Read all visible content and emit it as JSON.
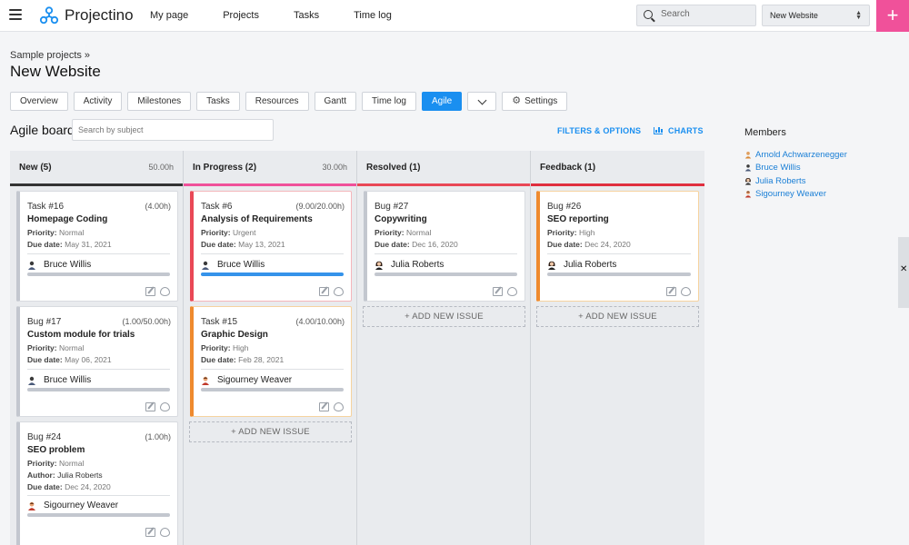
{
  "app": {
    "name": "Projectino"
  },
  "nav": {
    "my_page": "My page",
    "projects": "Projects",
    "tasks": "Tasks",
    "time_log": "Time log"
  },
  "search": {
    "placeholder": "Search"
  },
  "project_select": {
    "value": "New Website"
  },
  "colors": {
    "accent": "#1a8ff0",
    "plus": "#f0519a",
    "red": "#e94856",
    "orange": "#ef8a2e",
    "pink": "#f0519a",
    "dark": "#333333"
  },
  "breadcrumb": "Sample projects »",
  "page_title": "New Website",
  "tabs": [
    "Overview",
    "Activity",
    "Milestones",
    "Tasks",
    "Resources",
    "Gantt",
    "Time log",
    "Agile",
    "",
    "Settings"
  ],
  "board": {
    "title": "Agile board",
    "search_placeholder": "Search by subject",
    "filters_label": "FILTERS & OPTIONS",
    "charts_label": "CHARTS",
    "add_issue_label": "+ ADD NEW ISSUE",
    "columns": [
      {
        "name": "New (5)",
        "hours": "50.00h",
        "cards": [
          {
            "title": "Task #16",
            "estimate": "(4.00h)",
            "subject": "Homepage Coding",
            "priority_label": "Priority:",
            "priority": "Normal",
            "due_label": "Due date:",
            "due": "May 31, 2021",
            "assignee": "Bruce Willis",
            "progress": 0
          },
          {
            "title": "Bug #17",
            "estimate": "(1.00/50.00h)",
            "subject": "Custom module for trials",
            "priority_label": "Priority:",
            "priority": "Normal",
            "due_label": "Due date:",
            "due": "May 06, 2021",
            "assignee": "Bruce Willis",
            "progress": 0
          },
          {
            "title": "Bug #24",
            "estimate": "(1.00h)",
            "subject": "SEO problem",
            "priority_label": "Priority:",
            "priority": "Normal",
            "author_label": "Author:",
            "author": "Julia Roberts",
            "due_label": "Due date:",
            "due": "Dec 24, 2020",
            "assignee": "Sigourney Weaver",
            "progress": 0
          }
        ]
      },
      {
        "name": "In Progress (2)",
        "hours": "30.00h",
        "cards": [
          {
            "title": "Task #6",
            "estimate": "(9.00/20.00h)",
            "subject": "Analysis of Requirements",
            "priority_label": "Priority:",
            "priority": "Urgent",
            "due_label": "Due date:",
            "due": "May 13, 2021",
            "assignee": "Bruce Willis",
            "progress": 1
          },
          {
            "title": "Task #15",
            "estimate": "(4.00/10.00h)",
            "subject": "Graphic Design",
            "priority_label": "Priority:",
            "priority": "High",
            "due_label": "Due date:",
            "due": "Feb 28, 2021",
            "assignee": "Sigourney Weaver",
            "progress": 0
          }
        ]
      },
      {
        "name": "Resolved (1)",
        "hours": "",
        "cards": [
          {
            "title": "Bug #27",
            "estimate": "",
            "subject": "Copywriting",
            "priority_label": "Priority:",
            "priority": "Normal",
            "due_label": "Due date:",
            "due": "Dec 16, 2020",
            "assignee": "Julia Roberts",
            "progress": 0
          }
        ]
      },
      {
        "name": "Feedback (1)",
        "hours": "",
        "cards": [
          {
            "title": "Bug #26",
            "estimate": "",
            "subject": "SEO reporting",
            "priority_label": "Priority:",
            "priority": "High",
            "due_label": "Due date:",
            "due": "Dec 24, 2020",
            "assignee": "Julia Roberts",
            "progress": 0
          }
        ]
      }
    ]
  },
  "members": {
    "title": "Members",
    "list": [
      "Arnold Achwarzenegger",
      "Bruce Willis",
      "Julia Roberts",
      "Sigourney Weaver"
    ]
  }
}
